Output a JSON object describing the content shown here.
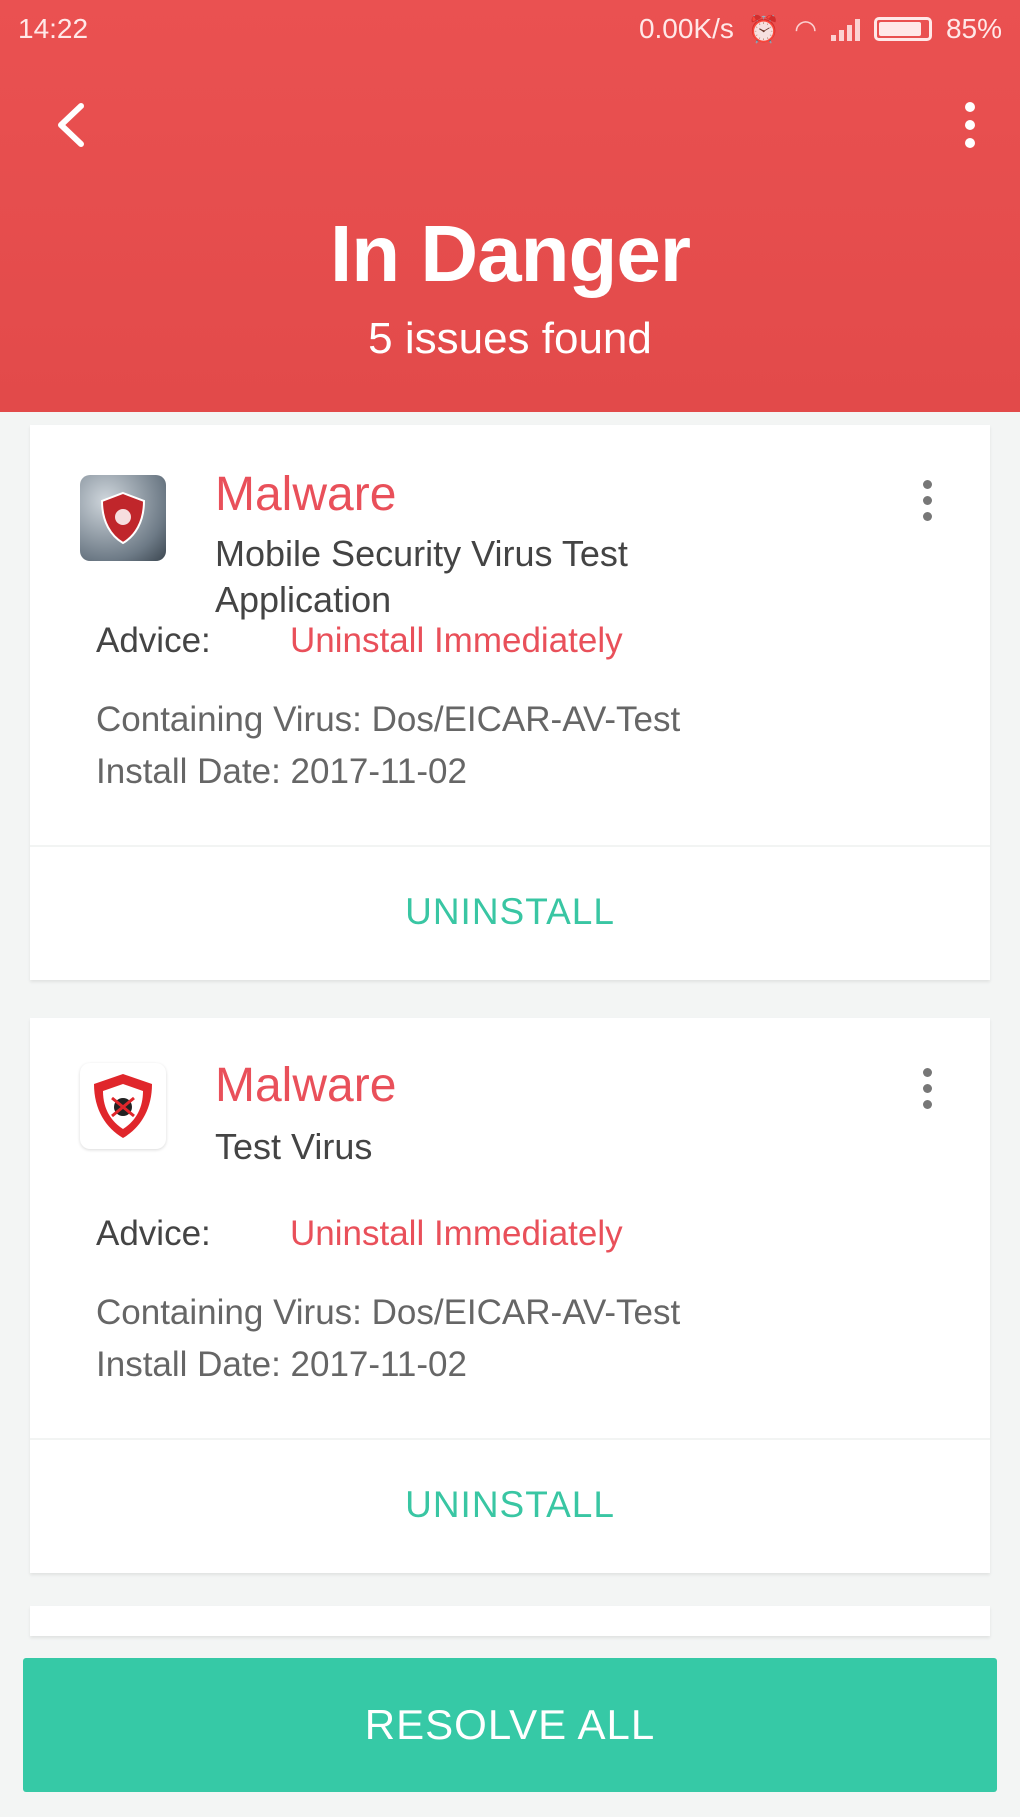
{
  "status_bar": {
    "time": "14:22",
    "network_speed": "0.00K/s",
    "battery": "85%",
    "icons": [
      "alarm-icon",
      "wifi-icon",
      "signal-icon",
      "battery-icon"
    ]
  },
  "header": {
    "title": "In Danger",
    "subtitle": "5 issues found",
    "background_color": "#e84f4f"
  },
  "issues": [
    {
      "threat_type": "Malware",
      "app_name": "Mobile Security Virus Test Application",
      "advice_label": "Advice:",
      "advice_value": "Uninstall Immediately",
      "virus_line": "Containing Virus: Dos/EICAR-AV-Test",
      "install_line": "Install Date: 2017-11-02",
      "action_label": "UNINSTALL",
      "icon": "security-app-icon"
    },
    {
      "threat_type": "Malware",
      "app_name": "Test Virus",
      "advice_label": "Advice:",
      "advice_value": "Uninstall Immediately",
      "virus_line": "Containing Virus: Dos/EICAR-AV-Test",
      "install_line": "Install Date: 2017-11-02",
      "action_label": "UNINSTALL",
      "icon": "shield-virus-icon"
    }
  ],
  "footer": {
    "resolve_label": "RESOLVE ALL",
    "accent_color": "#36c9a6"
  },
  "colors": {
    "danger_text": "#e9505a",
    "action_text": "#39c6a3"
  }
}
